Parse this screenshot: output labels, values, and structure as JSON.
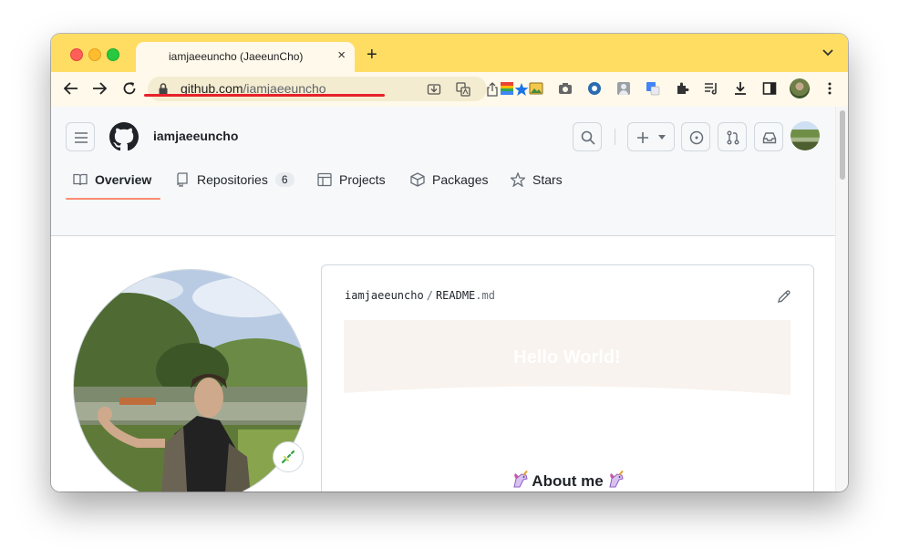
{
  "browser": {
    "tab_title": "iamjaeeuncho (JaeeunCho)",
    "tab_close": "×",
    "new_tab": "+",
    "url_domain": "github.com",
    "url_path": "/iamjaeeuncho"
  },
  "github": {
    "username": "iamjaeeuncho",
    "nav": {
      "overview": "Overview",
      "repositories": "Repositories",
      "repositories_count": "6",
      "projects": "Projects",
      "packages": "Packages",
      "stars": "Stars"
    },
    "readme": {
      "owner": "iamjaeeuncho",
      "separator": "/",
      "file_base": "README",
      "file_ext": ".md",
      "banner_text": "Hello World!",
      "about_heading": "About me"
    },
    "colors": {
      "accent_underline": "#fd8c73",
      "border": "#d0d7de"
    }
  },
  "annotation": {
    "underline_color": "#e8202a"
  }
}
